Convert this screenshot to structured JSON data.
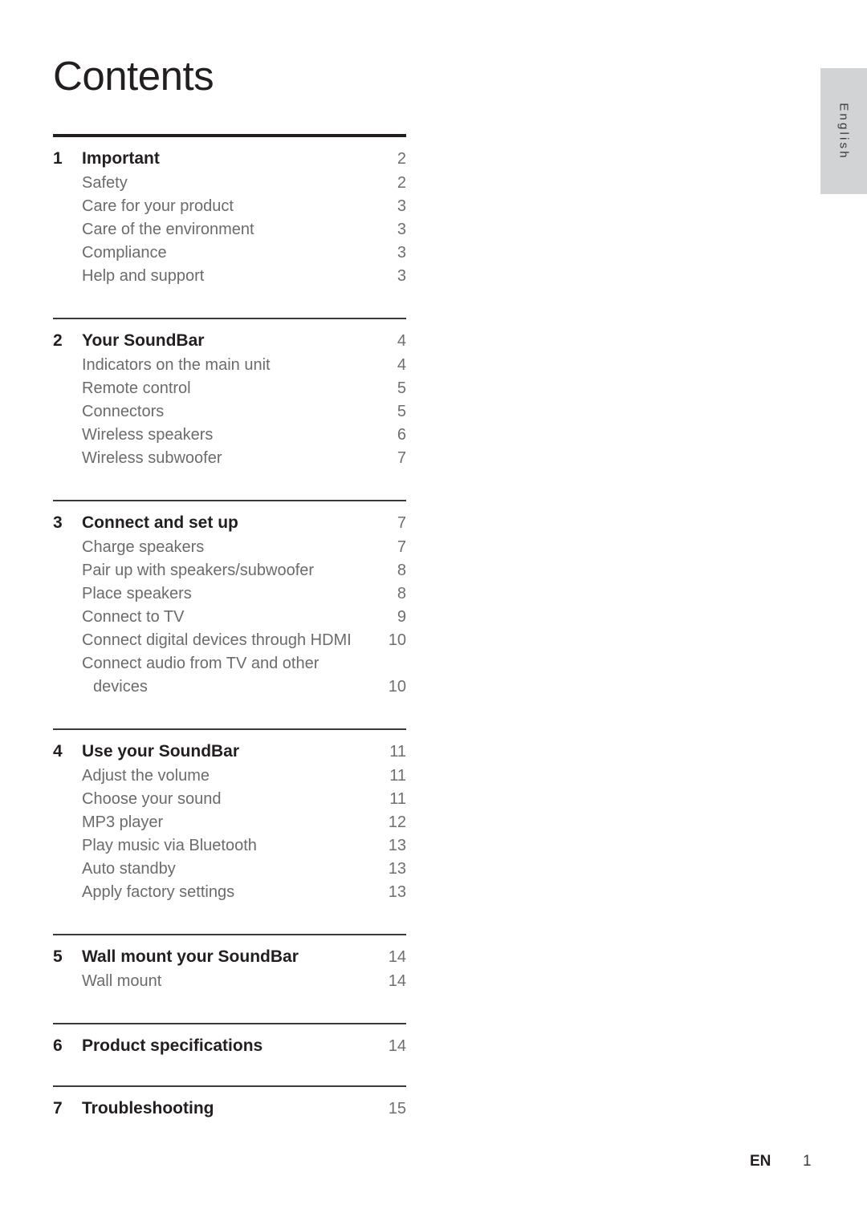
{
  "document": {
    "title": "Contents",
    "language_tab": "English"
  },
  "footer": {
    "language_code": "EN",
    "page_number": "1"
  },
  "toc": {
    "sections": [
      {
        "number": "1",
        "title": "Important",
        "page": "2",
        "items": [
          {
            "label": "Safety",
            "page": "2"
          },
          {
            "label": "Care for your product",
            "page": "3"
          },
          {
            "label": "Care of the environment",
            "page": "3"
          },
          {
            "label": "Compliance",
            "page": "3"
          },
          {
            "label": "Help and support",
            "page": "3"
          }
        ]
      },
      {
        "number": "2",
        "title": "Your SoundBar",
        "page": "4",
        "items": [
          {
            "label": "Indicators on the main unit",
            "page": "4"
          },
          {
            "label": "Remote control",
            "page": "5"
          },
          {
            "label": "Connectors",
            "page": "5"
          },
          {
            "label": "Wireless speakers",
            "page": "6"
          },
          {
            "label": "Wireless subwoofer",
            "page": "7"
          }
        ]
      },
      {
        "number": "3",
        "title": "Connect and set up",
        "page": "7",
        "items": [
          {
            "label": "Charge speakers",
            "page": "7"
          },
          {
            "label": "Pair up with speakers/subwoofer",
            "page": "8"
          },
          {
            "label": "Place speakers",
            "page": "8"
          },
          {
            "label": "Connect to TV",
            "page": "9"
          },
          {
            "label": "Connect digital devices through HDMI",
            "page": "10"
          },
          {
            "label": "Connect audio from TV and other",
            "page": ""
          },
          {
            "label": "devices",
            "page": "10",
            "continuation": true
          }
        ]
      },
      {
        "number": "4",
        "title": "Use your SoundBar",
        "page": "11",
        "items": [
          {
            "label": "Adjust the volume",
            "page": "11"
          },
          {
            "label": "Choose your sound",
            "page": "11"
          },
          {
            "label": "MP3 player",
            "page": "12"
          },
          {
            "label": "Play music via Bluetooth",
            "page": "13"
          },
          {
            "label": "Auto standby",
            "page": "13"
          },
          {
            "label": "Apply factory settings",
            "page": "13"
          }
        ]
      },
      {
        "number": "5",
        "title": "Wall mount your SoundBar",
        "page": "14",
        "items": [
          {
            "label": "Wall mount",
            "page": "14"
          }
        ]
      },
      {
        "number": "6",
        "title": "Product specifications",
        "page": "14",
        "items": []
      },
      {
        "number": "7",
        "title": "Troubleshooting",
        "page": "15",
        "items": []
      }
    ]
  }
}
